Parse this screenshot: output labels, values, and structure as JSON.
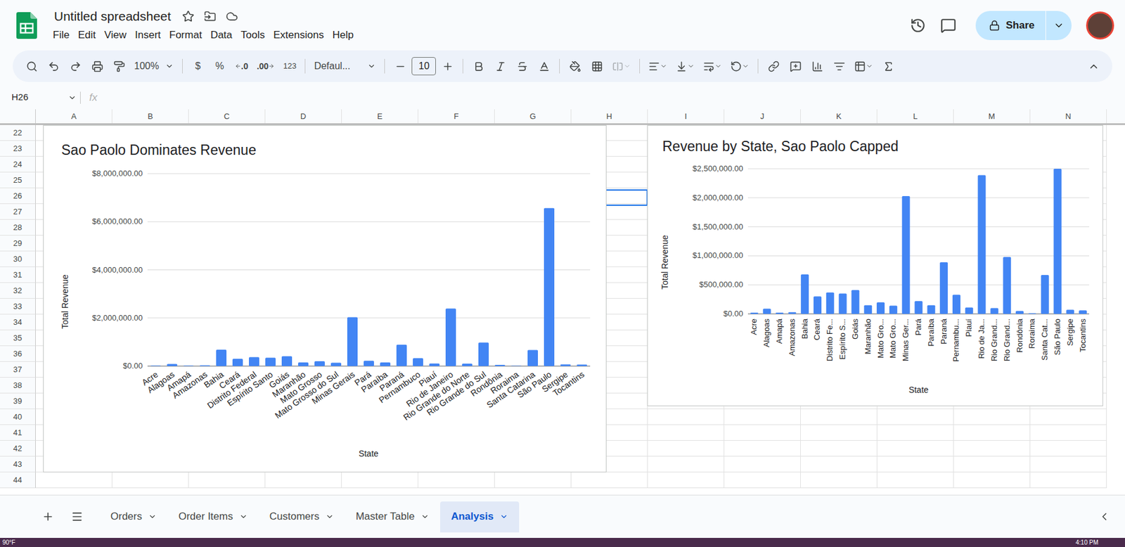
{
  "app": {
    "title": "Untitled spreadsheet",
    "menu": [
      "File",
      "Edit",
      "View",
      "Insert",
      "Format",
      "Data",
      "Tools",
      "Extensions",
      "Help"
    ],
    "share": "Share"
  },
  "toolbar": {
    "zoom": "100%",
    "currency": "$",
    "percent": "%",
    "decrease_decimal": ".0",
    "increase_decimal": ".00",
    "number_format": "123",
    "font": "Defaul...",
    "font_size": "10"
  },
  "formula_bar": {
    "name_box": "H26",
    "fx": "fx",
    "value": ""
  },
  "grid": {
    "columns": [
      "A",
      "B",
      "C",
      "D",
      "E",
      "F",
      "G",
      "H",
      "I",
      "J",
      "K",
      "L",
      "M",
      "N"
    ],
    "rows": [
      "22",
      "23",
      "24",
      "25",
      "26",
      "27",
      "28",
      "29",
      "30",
      "31",
      "32",
      "33",
      "34",
      "35",
      "36",
      "37",
      "38",
      "39",
      "40",
      "41",
      "42",
      "43",
      "44"
    ],
    "selected": {
      "column": "H",
      "row": "26"
    }
  },
  "charts": [
    {
      "kind": "angled",
      "title": "Sao Paolo Dominates Revenue",
      "y_axis_title": "Total Revenue",
      "x_axis_title": "State",
      "axis_max": 8000000,
      "ticks": [
        "$8,000,000.00",
        "$6,000,000.00",
        "$4,000,000.00",
        "$2,000,000.00",
        "$0.00"
      ],
      "categories": [
        "Acre",
        "Alagoas",
        "Amapá",
        "Amazonas",
        "Bahia",
        "Ceará",
        "Distrito Federal",
        "Espírito Santo",
        "Goiás",
        "Maranhão",
        "Mato Grosso",
        "Mato Grosso do Sul",
        "Minas Gerais",
        "Pará",
        "Paraíba",
        "Paraná",
        "Pernambuco",
        "Piauí",
        "Rio de Janeiro",
        "Rio Grande do Norte",
        "Rio Grande do Sul",
        "Rondônia",
        "Roraima",
        "Santa Catarina",
        "São Paulo",
        "Sergipe",
        "Tocantins"
      ],
      "values": [
        20000,
        90000,
        20000,
        30000,
        680000,
        300000,
        370000,
        350000,
        410000,
        150000,
        200000,
        140000,
        2030000,
        220000,
        150000,
        890000,
        330000,
        110000,
        2390000,
        100000,
        980000,
        50000,
        10000,
        670000,
        6570000,
        70000,
        60000
      ]
    },
    {
      "kind": "vertical",
      "title": "Revenue by State, Sao Paolo Capped",
      "y_axis_title": "Total Revenue",
      "x_axis_title": "State",
      "axis_max": 2500000,
      "ticks": [
        "$2,500,000.00",
        "$2,000,000.00",
        "$1,500,000.00",
        "$1,000,000.00",
        "$500,000.00",
        "$0.00"
      ],
      "categories": [
        "Acre",
        "Alagoas",
        "Amapá",
        "Amazonas",
        "Bahia",
        "Ceará",
        "Distrito Fe...",
        "Espírito S...",
        "Goiás",
        "Maranhão",
        "Mato Gro...",
        "Mato Gro...",
        "Minas Ger...",
        "Pará",
        "Paraíba",
        "Paraná",
        "Pernambu...",
        "Piauí",
        "Rio de Ja...",
        "Rio Grand...",
        "Rio Grand...",
        "Rondônia",
        "Roraima",
        "Santa Cat...",
        "São Paulo",
        "Sergipe",
        "Tocantins"
      ],
      "values": [
        20000,
        90000,
        20000,
        30000,
        680000,
        300000,
        370000,
        350000,
        410000,
        150000,
        200000,
        140000,
        2030000,
        220000,
        150000,
        890000,
        330000,
        110000,
        2390000,
        100000,
        980000,
        50000,
        10000,
        670000,
        2500000,
        70000,
        60000
      ]
    }
  ],
  "sheet_tabs": [
    {
      "label": "Orders",
      "selected": false
    },
    {
      "label": "Order Items",
      "selected": false
    },
    {
      "label": "Customers",
      "selected": false
    },
    {
      "label": "Master Table",
      "selected": false
    },
    {
      "label": "Analysis",
      "selected": true
    }
  ],
  "taskbar": {
    "weather": "90°F",
    "time": "4:10 PM"
  }
}
